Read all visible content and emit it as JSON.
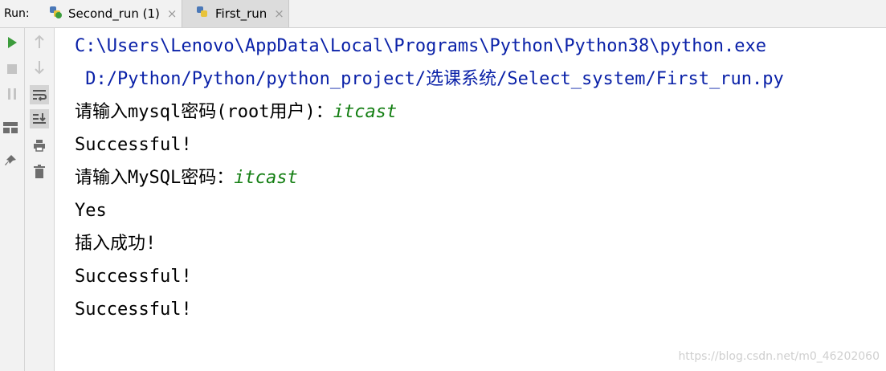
{
  "run_panel": {
    "label": "Run:",
    "tabs": [
      {
        "label": "Second_run (1)",
        "close": "×"
      },
      {
        "label": "First_run",
        "close": "×"
      }
    ]
  },
  "console": {
    "lines": [
      {
        "text": "C:\\Users\\Lenovo\\AppData\\Local\\Programs\\Python\\Python38\\python.exe"
      },
      {
        "text": " D:/Python/Python/python_project/选课系统/Select_system/First_run.py"
      },
      {
        "prompt": "请输入mysql密码(root用户)：",
        "input": "itcast"
      },
      {
        "text": "Successful!"
      },
      {
        "prompt": "请输入MySQL密码：",
        "input": "itcast"
      },
      {
        "text": "Yes"
      },
      {
        "text": "插入成功!"
      },
      {
        "text": "Successful!"
      },
      {
        "text": "Successful!"
      }
    ]
  },
  "watermark": "https://blog.csdn.net/m0_46202060",
  "icons": [
    "python-file-icon",
    "run-icon",
    "stop-icon",
    "pause-icon",
    "layout-icon",
    "pin-icon",
    "up-arrow-icon",
    "down-arrow-icon",
    "soft-wrap-icon",
    "scroll-to-end-icon",
    "print-icon",
    "trash-icon"
  ],
  "colors": {
    "path": "#0a21a8",
    "user_input": "#137e12",
    "run_green": "#3c9c3c"
  }
}
